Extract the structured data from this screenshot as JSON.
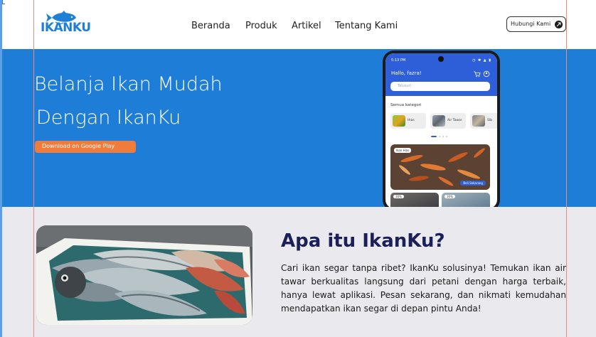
{
  "brand": {
    "name": "IKANKU",
    "color": "#1e7fd6"
  },
  "nav": {
    "items": [
      {
        "label": "Beranda"
      },
      {
        "label": "Produk"
      },
      {
        "label": "Artikel"
      },
      {
        "label": "Tentang Kami"
      }
    ],
    "contact_label": "Hubungi Kami",
    "contact_icon": "arrow-icon"
  },
  "hero": {
    "line1": "Belanja Ikan Mudah",
    "line2": "Dengan IkanKu",
    "cta_label": "Download on Google Play",
    "background": "#1e7dd6",
    "cta_color": "#f07c3c"
  },
  "phone": {
    "status_time": "5:13 PM",
    "greeting": "Hallo, fazra!",
    "search_placeholder": "Telusuri",
    "category_title": "Semua kategori",
    "categories": [
      {
        "label": "Hias"
      },
      {
        "label": "Air Tawar"
      },
      {
        "label": "Sib"
      }
    ],
    "banner_tag": "Ikan Hias",
    "banner_button": "Beli Sekarang",
    "tiles": [
      {
        "badge": "30%"
      },
      {
        "badge": "30%"
      }
    ]
  },
  "about": {
    "title": "Apa itu IkanKu?",
    "text": "Cari ikan segar tanpa ribet? IkanKu solusinya! Temukan ikan air tawar berkualitas langsung dari petani dengan harga terbaik, hanya lewat aplikasi. Pesan sekarang, dan nikmati kemudahan mendapatkan ikan segar di depan pintu Anda!",
    "title_color": "#1b1f5a",
    "background": "#eaeaee"
  }
}
